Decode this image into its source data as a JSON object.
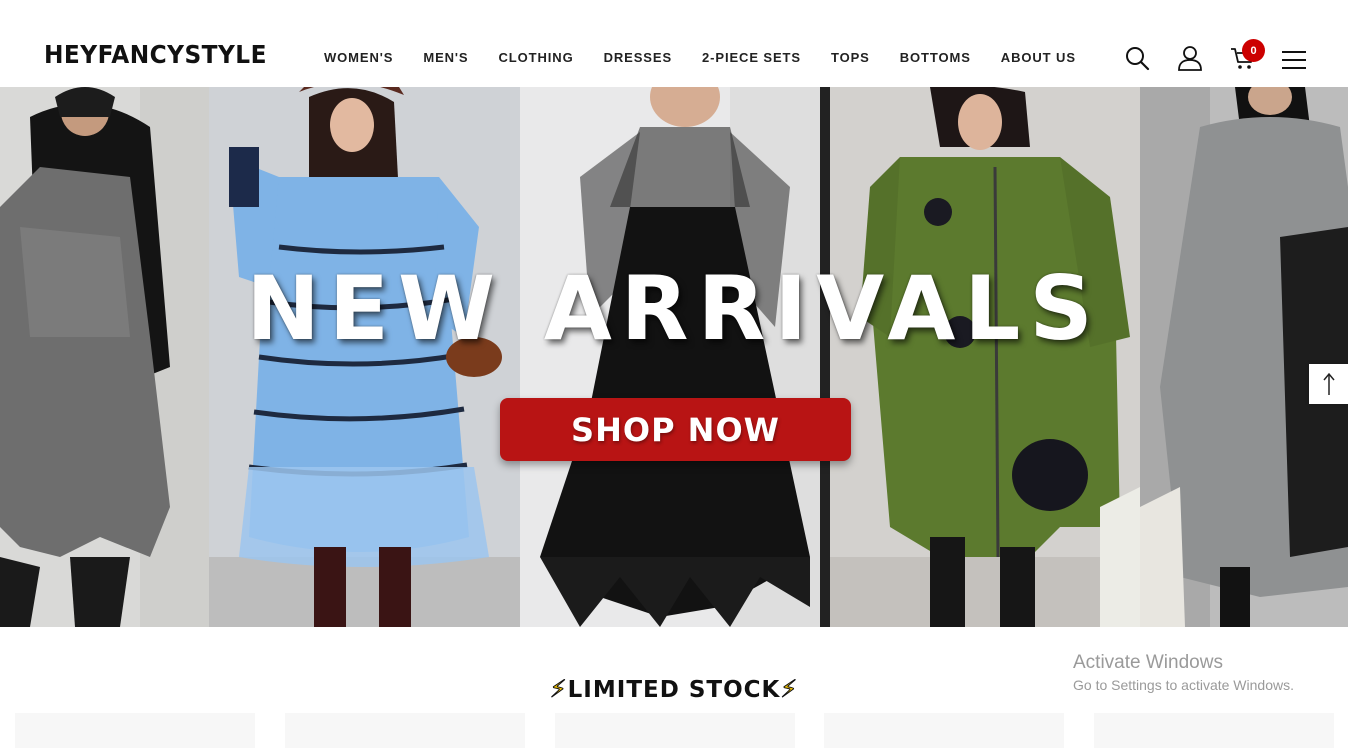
{
  "header": {
    "logo": "HEYFANCYSTYLE",
    "nav": [
      {
        "label": "WOMEN'S"
      },
      {
        "label": "MEN'S"
      },
      {
        "label": "CLOTHING"
      },
      {
        "label": "DRESSES"
      },
      {
        "label": "2-PIECE SETS"
      },
      {
        "label": "TOPS"
      },
      {
        "label": "BOTTOMS"
      },
      {
        "label": "ABOUT US"
      }
    ],
    "icons": [
      "search-icon",
      "user-icon",
      "cart-icon",
      "menu-icon"
    ],
    "cart_count": "0"
  },
  "hero": {
    "title": "NEW ARRIVALS",
    "cta_label": "SHOP NOW"
  },
  "section": {
    "title": "LIMITED STOCK",
    "bolt": "⚡"
  },
  "watermark": {
    "title": "Activate Windows",
    "subtitle": "Go to Settings to activate Windows."
  },
  "colors": {
    "accent_red": "#b81414",
    "badge_red": "#cc0000",
    "text_dark": "#111111"
  }
}
